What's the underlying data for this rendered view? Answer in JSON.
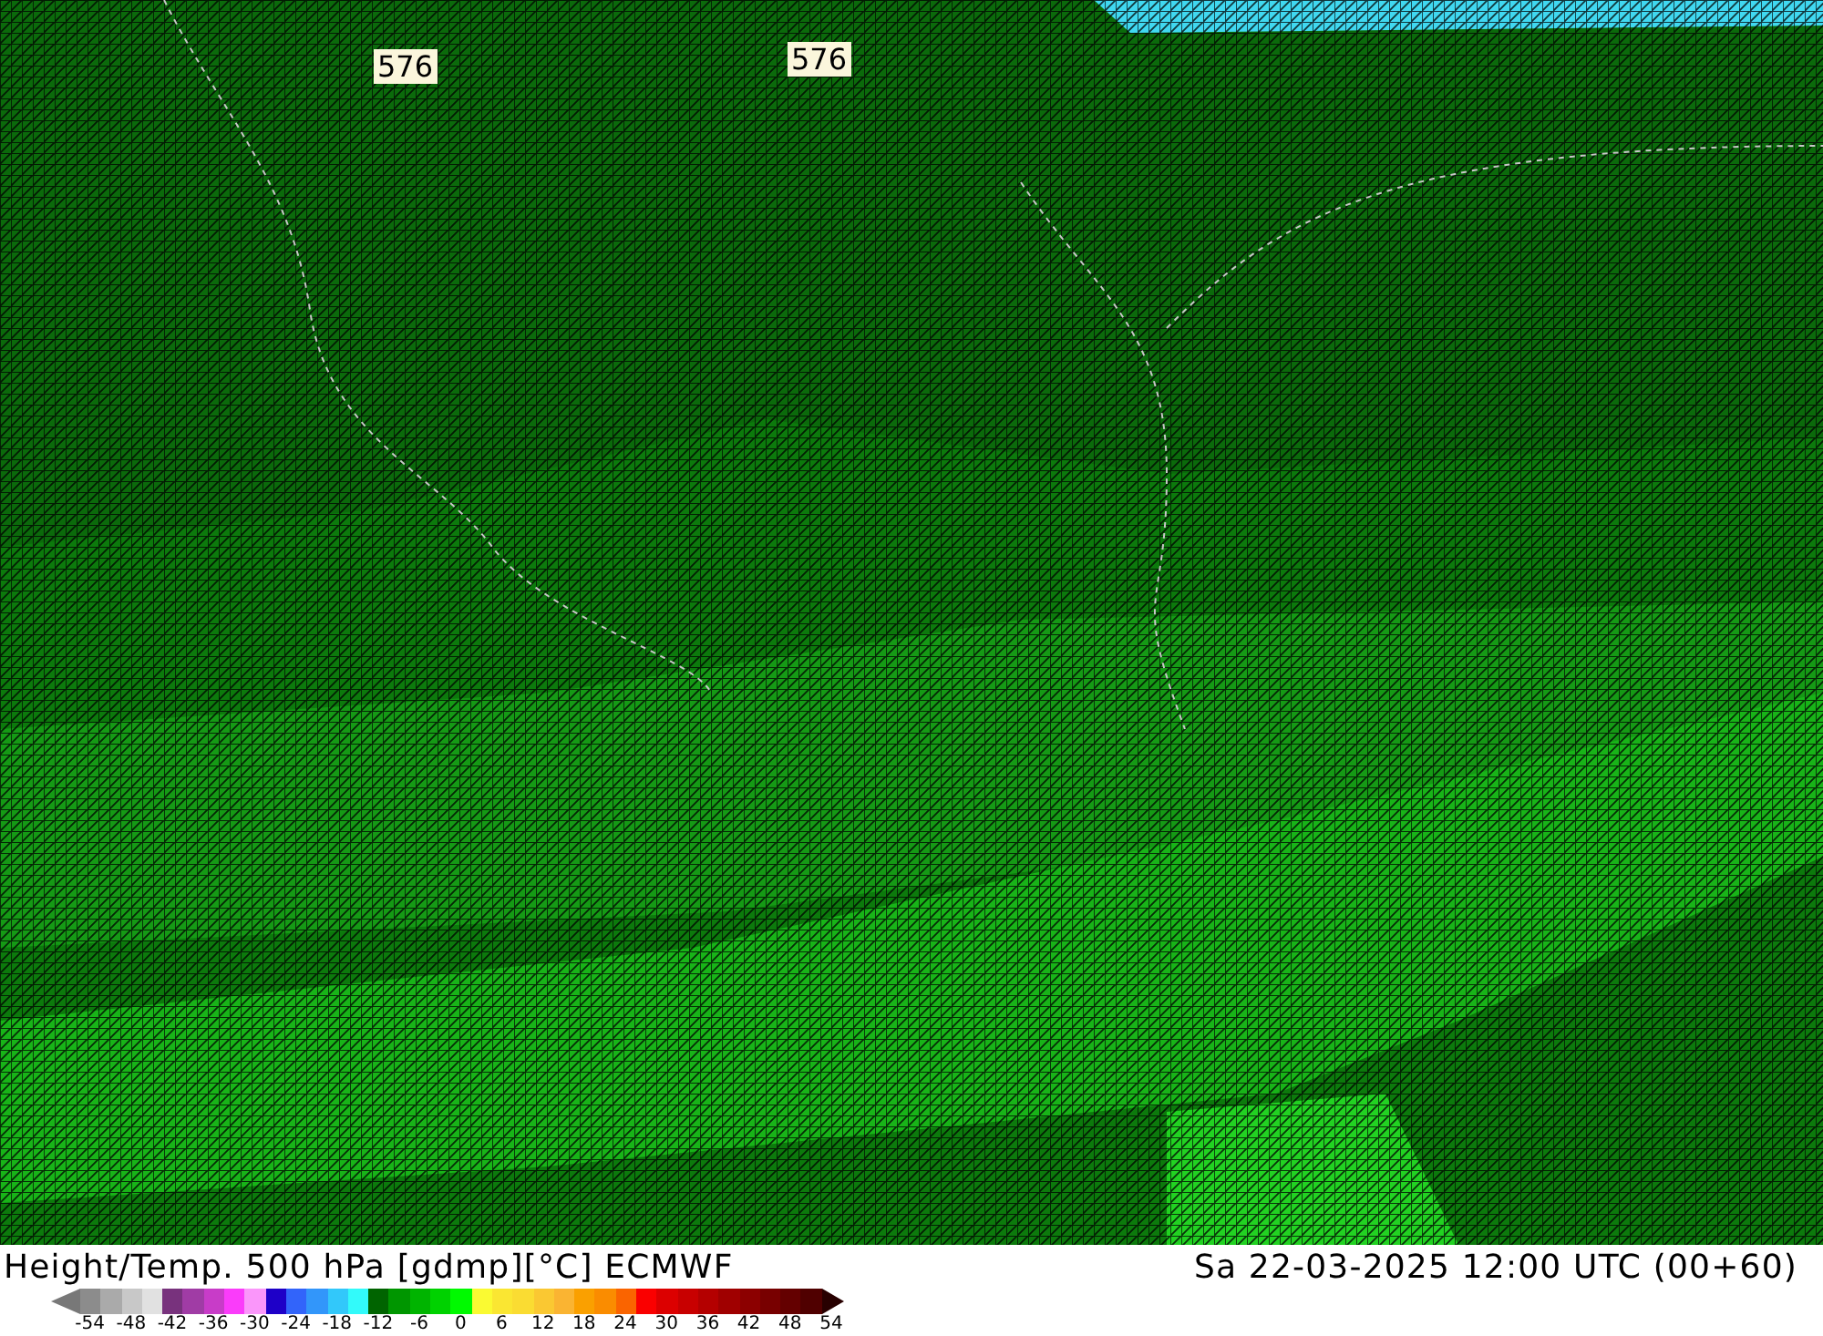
{
  "map": {
    "contour_labels": [
      {
        "text": "576"
      },
      {
        "text": "576"
      }
    ]
  },
  "footer": {
    "title": "Height/Temp. 500 hPa [gdmp][°C] ECMWF",
    "datetime": "Sa 22-03-2025 12:00 UTC (00+60)"
  },
  "legend": {
    "swatches": [
      {
        "color": "#8c8c8c"
      },
      {
        "color": "#aaaaaa"
      },
      {
        "color": "#c8c8c8"
      },
      {
        "color": "#e1e1e1"
      },
      {
        "color": "#78327d"
      },
      {
        "color": "#a03ca5"
      },
      {
        "color": "#c83cc8"
      },
      {
        "color": "#fa3cfa"
      },
      {
        "color": "#fa96fa"
      },
      {
        "color": "#1e00c8"
      },
      {
        "color": "#3264fa"
      },
      {
        "color": "#3296fa"
      },
      {
        "color": "#32c8fa"
      },
      {
        "color": "#32fafa"
      },
      {
        "color": "#006400"
      },
      {
        "color": "#009600"
      },
      {
        "color": "#00b400"
      },
      {
        "color": "#00d200"
      },
      {
        "color": "#00fa00"
      },
      {
        "color": "#fafa32"
      },
      {
        "color": "#fae632"
      },
      {
        "color": "#fadc32"
      },
      {
        "color": "#fac832"
      },
      {
        "color": "#fab432"
      },
      {
        "color": "#faa000"
      },
      {
        "color": "#fa8c00"
      },
      {
        "color": "#fa6400"
      },
      {
        "color": "#fa0000"
      },
      {
        "color": "#dc0000"
      },
      {
        "color": "#c80000"
      },
      {
        "color": "#b40000"
      },
      {
        "color": "#a00000"
      },
      {
        "color": "#8c0000"
      },
      {
        "color": "#780000"
      },
      {
        "color": "#640000"
      },
      {
        "color": "#500000"
      }
    ],
    "ticks": [
      "-54",
      "-48",
      "-42",
      "-36",
      "-30",
      "-24",
      "-18",
      "-12",
      "-6",
      "0",
      "6",
      "12",
      "18",
      "24",
      "30",
      "36",
      "42",
      "48",
      "54"
    ]
  }
}
